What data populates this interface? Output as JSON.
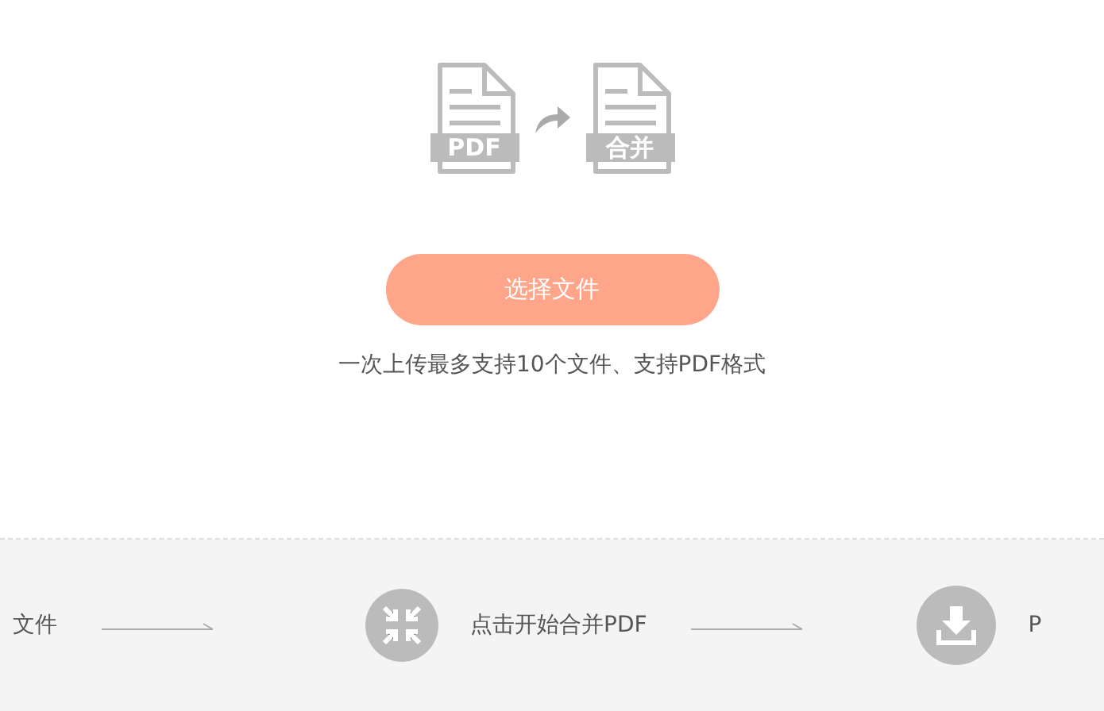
{
  "illustration": {
    "source_label": "PDF",
    "target_label": "合并"
  },
  "upload_button": {
    "label": "选择文件"
  },
  "hint": "一次上传最多支持10个文件、支持PDF格式",
  "steps": [
    {
      "kind": "text",
      "label": "文件"
    },
    {
      "kind": "compress",
      "label": "点击开始合并PDF"
    },
    {
      "kind": "download",
      "label": "P"
    }
  ]
}
